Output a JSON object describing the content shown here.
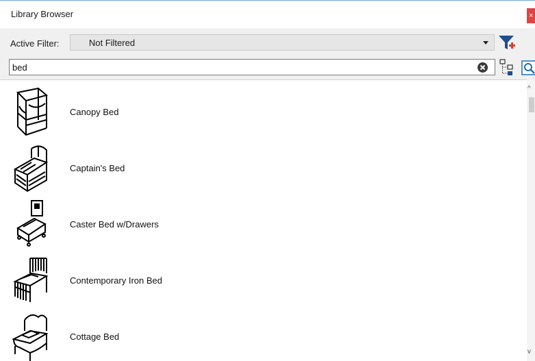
{
  "window": {
    "title": "Library Browser",
    "close_glyph": "×"
  },
  "filter": {
    "label": "Active Filter:",
    "value": "Not Filtered"
  },
  "search": {
    "value": "bed"
  },
  "items": [
    {
      "label": "Canopy Bed",
      "icon": "canopy-bed-icon"
    },
    {
      "label": "Captain's Bed",
      "icon": "captains-bed-icon"
    },
    {
      "label": "Caster Bed w/Drawers",
      "icon": "caster-bed-icon"
    },
    {
      "label": "Contemporary Iron Bed",
      "icon": "iron-bed-icon"
    },
    {
      "label": "Cottage Bed",
      "icon": "cottage-bed-icon"
    }
  ],
  "colors": {
    "close": "#e04343",
    "filter_icon": "#1f4e8c",
    "filter_plus": "#e0392b",
    "accent_border": "#6ea8d8"
  }
}
